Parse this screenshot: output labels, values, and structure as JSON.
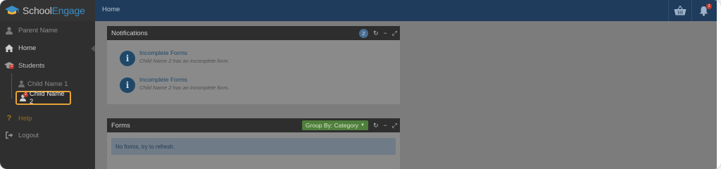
{
  "logo": {
    "part1": "School",
    "part2": "Engage"
  },
  "header": {
    "title": "Home",
    "bell_badge": "2"
  },
  "sidebar": {
    "user_name": "Parent Name",
    "home_label": "Home",
    "students_label": "Students",
    "students_badge": "2",
    "children": [
      {
        "label": "Child Name 1"
      },
      {
        "label": "Child Name 2",
        "badge": "2"
      }
    ],
    "help_label": "Help",
    "logout_label": "Logout"
  },
  "notifications": {
    "title": "Notifications",
    "count": "2",
    "items": [
      {
        "title": "Incomplete Forms",
        "sub": "Child Name 2 has an incomplete form."
      },
      {
        "title": "Incomplete Forms",
        "sub": "Child Name 2 has an incomplete form."
      }
    ]
  },
  "forms": {
    "title": "Forms",
    "group_by_label": "Group By: Category",
    "empty_text": "No forms, try to refresh."
  },
  "colors": {
    "header_bg": "#1f3c5d",
    "sidebar_bg": "#2f2f2f",
    "highlight": "#e8a23a",
    "badge": "#c0392b",
    "group_button": "#4f7f3c"
  }
}
